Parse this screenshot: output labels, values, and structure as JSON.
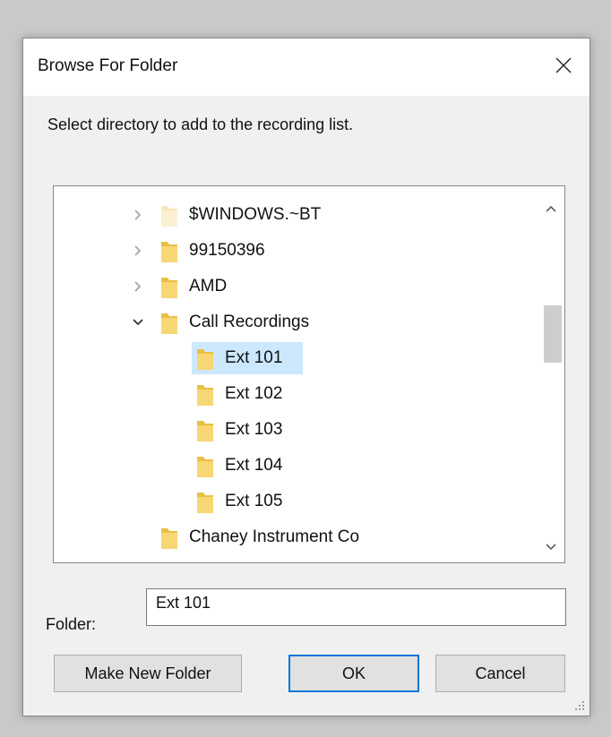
{
  "window": {
    "title": "Browse For Folder"
  },
  "instruction": "Select directory to add to the recording list.",
  "tree": {
    "items": [
      {
        "label": "$WINDOWS.~BT",
        "expander": "collapsed",
        "level": 0
      },
      {
        "label": "99150396",
        "expander": "collapsed",
        "level": 0
      },
      {
        "label": "AMD",
        "expander": "collapsed",
        "level": 0
      },
      {
        "label": "Call Recordings",
        "expander": "expanded",
        "level": 0
      },
      {
        "label": "Ext 101",
        "expander": "none",
        "level": 1,
        "selected": true
      },
      {
        "label": "Ext 102",
        "expander": "none",
        "level": 1
      },
      {
        "label": "Ext 103",
        "expander": "none",
        "level": 1
      },
      {
        "label": "Ext 104",
        "expander": "none",
        "level": 1
      },
      {
        "label": "Ext 105",
        "expander": "none",
        "level": 1
      },
      {
        "label": "Chaney Instrument Co",
        "expander": "none",
        "level": 0
      }
    ]
  },
  "folder_field": {
    "label": "Folder:",
    "value": "Ext 101"
  },
  "buttons": {
    "make_new_folder": "Make New Folder",
    "ok": "OK",
    "cancel": "Cancel"
  },
  "colors": {
    "selection": "#cce8ff",
    "folder": "#f7d774",
    "default_button_border": "#0078d7"
  },
  "icons": {
    "close": "close-icon",
    "expand": "chevron-right-icon",
    "collapse": "chevron-down-icon",
    "folder": "folder-icon"
  }
}
